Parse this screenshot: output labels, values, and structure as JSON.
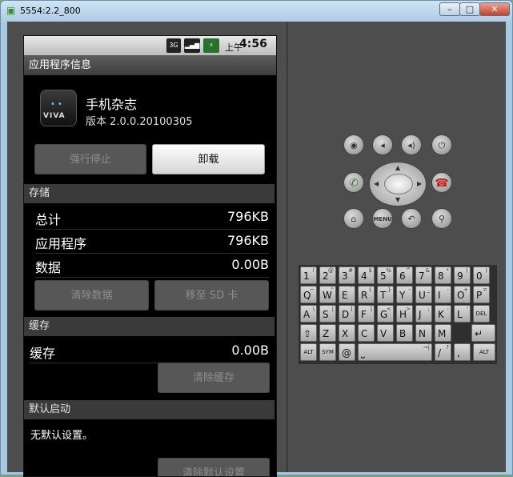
{
  "window": {
    "title": "5554:2.2_800",
    "minimize_label": "–",
    "maximize_label": "□",
    "close_label": "✕"
  },
  "status_bar": {
    "network": "3G",
    "time_prefix": "上午",
    "time": "4:56"
  },
  "header": {
    "title": "应用程序信息"
  },
  "app": {
    "name": "手机杂志",
    "version": "版本 2.0.0.20100305",
    "icon_text": "VIVA",
    "icon": "viva-app-icon"
  },
  "buttons": {
    "force_stop": "强行停止",
    "uninstall": "卸载",
    "clear_data": "清除数据",
    "move_to_sd": "移至 SD 卡",
    "clear_cache": "清除缓存",
    "clear_defaults": "清除默认设置"
  },
  "storage": {
    "section_title": "存储",
    "rows": [
      {
        "label": "总计",
        "value": "796KB"
      },
      {
        "label": "应用程序",
        "value": "796KB"
      },
      {
        "label": "数据",
        "value": "0.00B"
      }
    ]
  },
  "cache": {
    "section_title": "缓存",
    "label": "缓存",
    "value": "0.00B"
  },
  "launch_default": {
    "section_title": "默认启动",
    "text": "无默认设置。"
  },
  "controls": {
    "menu_label": "MENU",
    "icons": [
      "camera-icon",
      "volume-down-icon",
      "volume-up-icon",
      "power-icon",
      "call-icon",
      "end-call-icon",
      "home-icon",
      "menu-icon",
      "back-icon",
      "search-icon"
    ]
  },
  "keyboard": {
    "row1": [
      [
        "1",
        "!"
      ],
      [
        "2",
        "@"
      ],
      [
        "3",
        "#"
      ],
      [
        "4",
        "$"
      ],
      [
        "5",
        "%"
      ],
      [
        "6",
        "^"
      ],
      [
        "7",
        "&"
      ],
      [
        "8",
        "*"
      ],
      [
        "9",
        "("
      ],
      [
        "0",
        ")"
      ]
    ],
    "row2": [
      [
        "Q",
        "~"
      ],
      [
        "W",
        "\""
      ],
      [
        "E",
        "`"
      ],
      [
        "R",
        "{"
      ],
      [
        "T",
        "}"
      ],
      [
        "Y",
        "-"
      ],
      [
        "U",
        "_"
      ],
      [
        "I",
        "-"
      ],
      [
        "O",
        "+"
      ],
      [
        "P",
        "="
      ]
    ],
    "row3": [
      [
        "A",
        "\\"
      ],
      [
        "S",
        "|"
      ],
      [
        "D",
        "["
      ],
      [
        "F",
        "]"
      ],
      [
        "G",
        "<"
      ],
      [
        "H",
        ">"
      ],
      [
        "J",
        ";"
      ],
      [
        "K",
        ":"
      ],
      [
        "L",
        "'"
      ],
      [
        "DEL",
        ""
      ]
    ],
    "row4": [
      [
        "⇧",
        ""
      ],
      [
        "Z",
        ""
      ],
      [
        "X",
        ""
      ],
      [
        "C",
        ""
      ],
      [
        "V",
        ""
      ],
      [
        "B",
        ""
      ],
      [
        "N",
        ""
      ],
      [
        "M",
        ""
      ],
      [
        "↵",
        ""
      ]
    ],
    "row5": [
      [
        "ALT",
        ""
      ],
      [
        "SYM",
        ""
      ],
      [
        "@",
        ""
      ],
      [
        "⎵",
        "→|"
      ],
      [
        "/",
        "?"
      ],
      [
        ",",
        ""
      ],
      [
        "ALT",
        ""
      ]
    ]
  }
}
